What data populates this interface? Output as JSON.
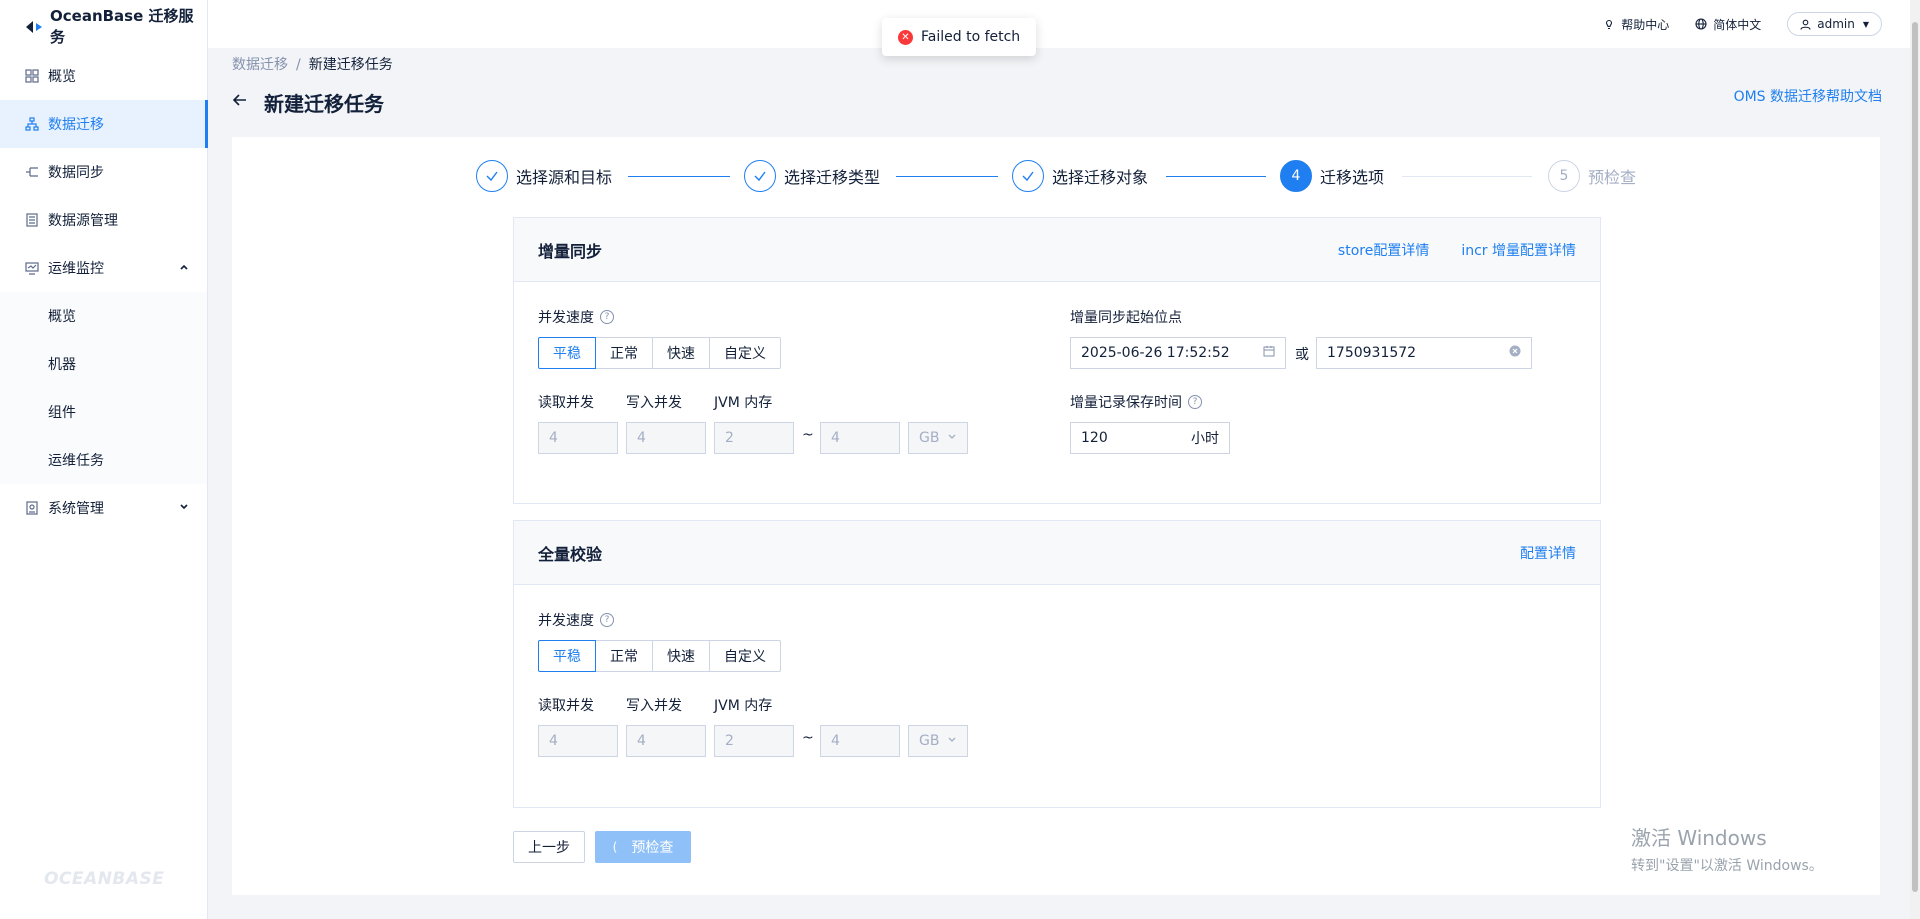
{
  "app": {
    "brand": "OceanBase 迁移服务",
    "side_brand": "OCEANBASE"
  },
  "sidebar": {
    "items": [
      {
        "label": "概览",
        "icon": "grid-icon"
      },
      {
        "label": "数据迁移",
        "icon": "migrate-icon",
        "active": true
      },
      {
        "label": "数据同步",
        "icon": "sync-icon"
      },
      {
        "label": "数据源管理",
        "icon": "datasource-icon"
      },
      {
        "label": "运维监控",
        "icon": "monitor-icon",
        "expanded": true
      },
      {
        "label": "系统管理",
        "icon": "system-icon",
        "expanded": false
      }
    ],
    "sub_items": [
      "概览",
      "机器",
      "组件",
      "运维任务"
    ]
  },
  "topbar": {
    "help": "帮助中心",
    "lang": "简体中文",
    "user": "admin"
  },
  "toast": {
    "message": "Failed to fetch"
  },
  "breadcrumb": {
    "parent": "数据迁移",
    "current": "新建迁移任务",
    "sep": "/"
  },
  "page": {
    "title": "新建迁移任务",
    "help_doc": "OMS 数据迁移帮助文档"
  },
  "steps": [
    {
      "label": "选择源和目标",
      "status": "done"
    },
    {
      "label": "选择迁移类型",
      "status": "done"
    },
    {
      "label": "选择迁移对象",
      "status": "done"
    },
    {
      "label": "迁移选项",
      "status": "current",
      "num": "4"
    },
    {
      "label": "预检查",
      "status": "wait",
      "num": "5"
    }
  ],
  "incr": {
    "title": "增量同步",
    "link1": "store配置详情",
    "link2": "incr 增量配置详情",
    "speed_label": "并发速度",
    "speed_options": [
      "平稳",
      "正常",
      "快速",
      "自定义"
    ],
    "read_label": "读取并发",
    "write_label": "写入并发",
    "jvm_label": "JVM 内存",
    "read_value": "4",
    "write_value": "4",
    "jvm_min": "2",
    "jvm_max": "4",
    "jvm_unit": "GB",
    "tilde": "~",
    "start_label": "增量同步起始位点",
    "start_time": "2025-06-26 17:52:52",
    "or": "或",
    "timestamp": "1750931572",
    "retention_label": "增量记录保存时间",
    "retention_value": "120",
    "retention_unit": "小时"
  },
  "full": {
    "title": "全量校验",
    "link": "配置详情",
    "speed_label": "并发速度",
    "speed_options": [
      "平稳",
      "正常",
      "快速",
      "自定义"
    ],
    "read_label": "读取并发",
    "write_label": "写入并发",
    "jvm_label": "JVM 内存",
    "read_value": "4",
    "write_value": "4",
    "jvm_min": "2",
    "jvm_max": "4",
    "jvm_unit": "GB",
    "tilde": "~"
  },
  "footer": {
    "prev": "上一步",
    "precheck": "预检查"
  },
  "watermark": {
    "line1": "激活 Windows",
    "line2": "转到\"设置\"以激活 Windows。"
  },
  "colors": {
    "accent": "#1f7ff0",
    "error": "#f93939"
  }
}
